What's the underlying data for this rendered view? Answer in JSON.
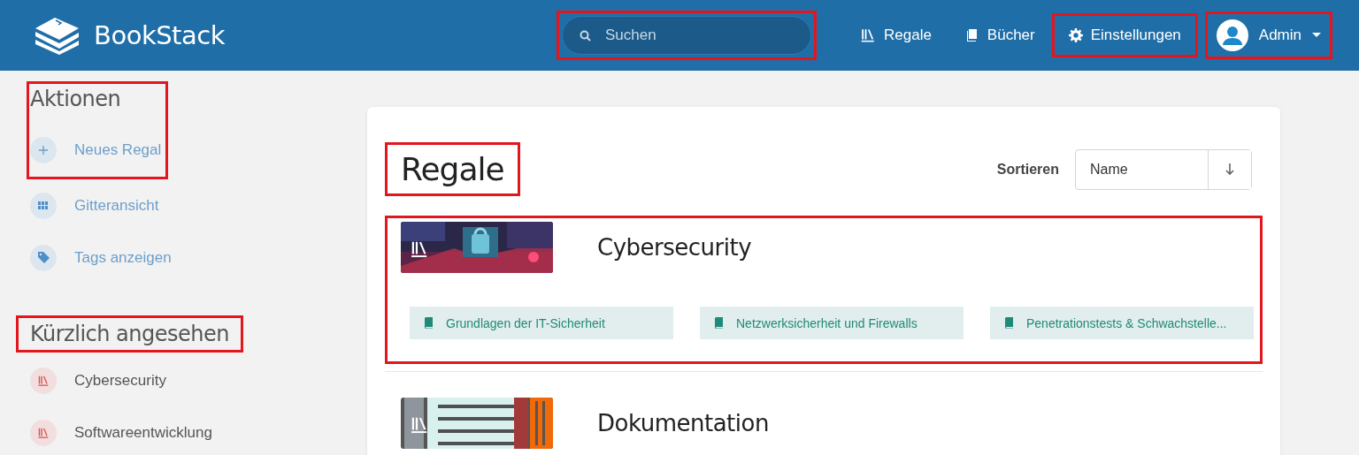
{
  "header": {
    "app_name": "BookStack",
    "search": {
      "placeholder": "Suchen",
      "highlighted": true
    },
    "nav": [
      {
        "label": "Regale",
        "highlighted": false
      },
      {
        "label": "Bücher",
        "highlighted": false
      },
      {
        "label": "Einstellungen",
        "highlighted": true
      }
    ],
    "user": {
      "name": "Admin",
      "highlighted": true
    }
  },
  "sidebar": {
    "actions": {
      "heading": "Aktionen",
      "highlighted": true,
      "items": [
        {
          "label": "Neues Regal"
        },
        {
          "label": "Gitteransicht"
        },
        {
          "label": "Tags anzeigen"
        }
      ]
    },
    "recent": {
      "heading": "Kürzlich angesehen",
      "highlighted": true,
      "items": [
        {
          "label": "Cybersecurity"
        },
        {
          "label": "Softwareentwicklung"
        }
      ]
    }
  },
  "main": {
    "title": "Regale",
    "title_highlighted": true,
    "sort": {
      "label": "Sortieren",
      "value": "Name"
    },
    "shelves": [
      {
        "name": "Cybersecurity",
        "highlighted": true,
        "books": [
          {
            "title": "Grundlagen der IT-Sicherheit"
          },
          {
            "title": "Netzwerksicherheit und Firewalls"
          },
          {
            "title": "Penetrationstests & Schwachstelle..."
          }
        ]
      },
      {
        "name": "Dokumentation",
        "highlighted": false
      }
    ]
  }
}
